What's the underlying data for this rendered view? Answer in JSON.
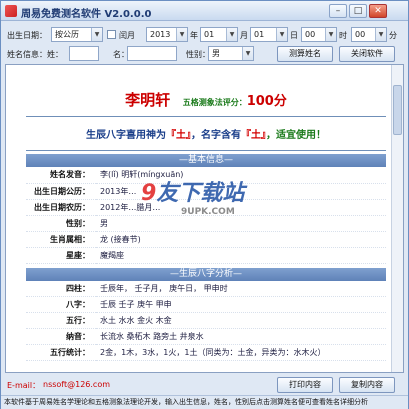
{
  "window": {
    "title": "周易免费测名软件 V2.0.0.0",
    "min": "–",
    "max": "□",
    "close": "✕"
  },
  "form": {
    "birth_label": "出生日期：",
    "calendar_type": "按公历",
    "leap_label": "闰月",
    "year": "2013",
    "year_unit": "年",
    "month": "01",
    "month_unit": "月",
    "day": "01",
    "day_unit": "日",
    "hour": "00",
    "hour_unit": "时",
    "minute": "00",
    "minute_unit": "分",
    "surname_label": "姓名信息：姓：",
    "given_label": "名：",
    "gender_label": "性别：",
    "gender": "男",
    "calc_button": "测算姓名",
    "close_button": "关闭软件"
  },
  "result": {
    "name": "李明轩",
    "score_label": "五格测象法评分：",
    "score": "100分",
    "banner_pre": "生辰八字喜用神为",
    "banner_elem1": "『土』",
    "banner_mid": "，名字含有",
    "banner_elem2": "『土』",
    "banner_post": "，适宜使用！",
    "basic_header": "基本信息",
    "basic": [
      {
        "k": "姓名发音：",
        "v": "李(lǐ) 明轩(míngxuān)"
      },
      {
        "k": "出生日期公历：",
        "v": "2013年…"
      },
      {
        "k": "出生日期农历：",
        "v": "2012年…腊月…"
      },
      {
        "k": "性别：",
        "v": "男"
      },
      {
        "k": "生肖属相：",
        "v": "龙  (接春节)"
      },
      {
        "k": "星座：",
        "v": "魔羯座"
      }
    ],
    "bazi_header": "生辰八字分析",
    "bazi": [
      {
        "k": "四柱：",
        "v": "壬辰年，  壬子月，  庚午日，  甲申时"
      },
      {
        "k": "八字：",
        "v": "壬辰  壬子  庚午  甲申"
      },
      {
        "k": "五行：",
        "v": "水土  水水  金火  木金"
      },
      {
        "k": "纳音：",
        "v": "长流水  桑柘木  路旁土  井泉水"
      },
      {
        "k": "五行统计：",
        "v": "2金，1木，3水，1火，1土（同类为：土金，异类为：水木火）"
      }
    ],
    "watermark_main": "友下载站",
    "watermark_first": "9",
    "watermark_sub": "9UPK.COM"
  },
  "bottom": {
    "email_label": "E-mail：",
    "email": "nssoft@126.com",
    "print_button": "打印内容",
    "copy_button": "复制内容"
  },
  "status": "本软件基于周易姓名学理论和五格测象法理论开发，输入出生信息，姓名，性别后点击测算姓名便可查看姓名详细分析"
}
